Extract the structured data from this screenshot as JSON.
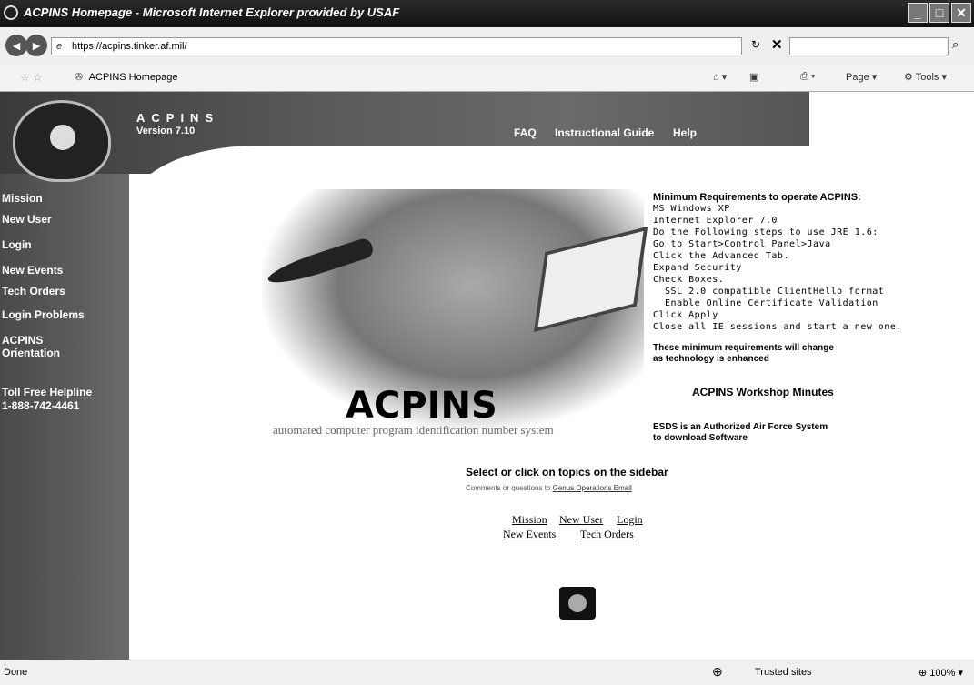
{
  "window": {
    "title": "ACPINS Homepage - Microsoft Internet Explorer provided by USAF"
  },
  "address_bar": {
    "url": "https://acpins.tinker.af.mil/"
  },
  "tab_bar": {
    "tab_title": "ACPINS Homepage",
    "page_menu": "Page",
    "tools_menu": "Tools"
  },
  "header": {
    "brand": "ACPINS",
    "version": "Version 7.10",
    "nav": [
      "FAQ",
      "Instructional Guide",
      "Help"
    ]
  },
  "sidebar": {
    "items": [
      "Mission",
      "New User",
      "Login",
      "New Events",
      "Tech Orders",
      "Login Problems",
      "ACPINS",
      "Orientation"
    ],
    "helpline_label": "Toll Free Helpline",
    "helpline_number": "1-888-742-4461"
  },
  "hero": {
    "title": "ACPINS",
    "tagline": "automated computer program identification number system"
  },
  "requirements": {
    "heading": "Minimum Requirements to operate ACPINS:",
    "lines": [
      "MS Windows XP",
      "Internet Explorer 7.0",
      "Do the Following steps to use JRE 1.6:",
      "Go to Start>Control Panel>Java",
      "Click the Advanced Tab.",
      "Expand Security",
      "Check Boxes.",
      "  SSL 2.0 compatible ClientHello format",
      "  Enable Online Certificate Validation",
      "Click Apply",
      "Close all IE sessions and start a new one."
    ],
    "footer": [
      "These minimum requirements will change",
      "as technology is enhanced"
    ]
  },
  "workshop_link": "ACPINS Workshop Minutes",
  "esds": [
    "ESDS is an Authorized Air Force System",
    "to download Software"
  ],
  "main": {
    "select_prompt": "Select or click on topics on the sidebar",
    "comments_prefix": "Comments or questions to",
    "comments_link": "Genus Operations Email",
    "bottom_links_row1": [
      "Mission",
      "New User",
      "Login"
    ],
    "bottom_links_row2": [
      "New Events",
      "Tech Orders"
    ]
  },
  "status_bar": {
    "status": "Done",
    "zone": "Trusted sites",
    "zoom": "100%"
  }
}
